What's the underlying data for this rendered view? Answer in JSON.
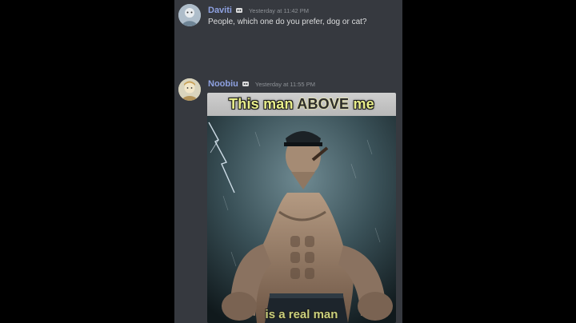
{
  "messages": [
    {
      "username": "Daviti",
      "badge_icon": "bot-badge-icon",
      "timestamp": "Yesterday at 11:42 PM",
      "text": "People, which one do you prefer, dog or cat?"
    },
    {
      "username": "Noobiu",
      "badge_icon": "bot-badge-icon",
      "timestamp": "Yesterday at 11:55 PM",
      "attachment": {
        "caption_top_part1": "This man ",
        "caption_top_emphasis": "ABOVE",
        "caption_top_part2": " me",
        "caption_bottom": "is a real man"
      }
    }
  ],
  "colors": {
    "background": "#36393f",
    "username": "#8ea1e1",
    "timestamp": "#8e9297",
    "text": "#dcddde",
    "caption": "#e9ee8a"
  }
}
